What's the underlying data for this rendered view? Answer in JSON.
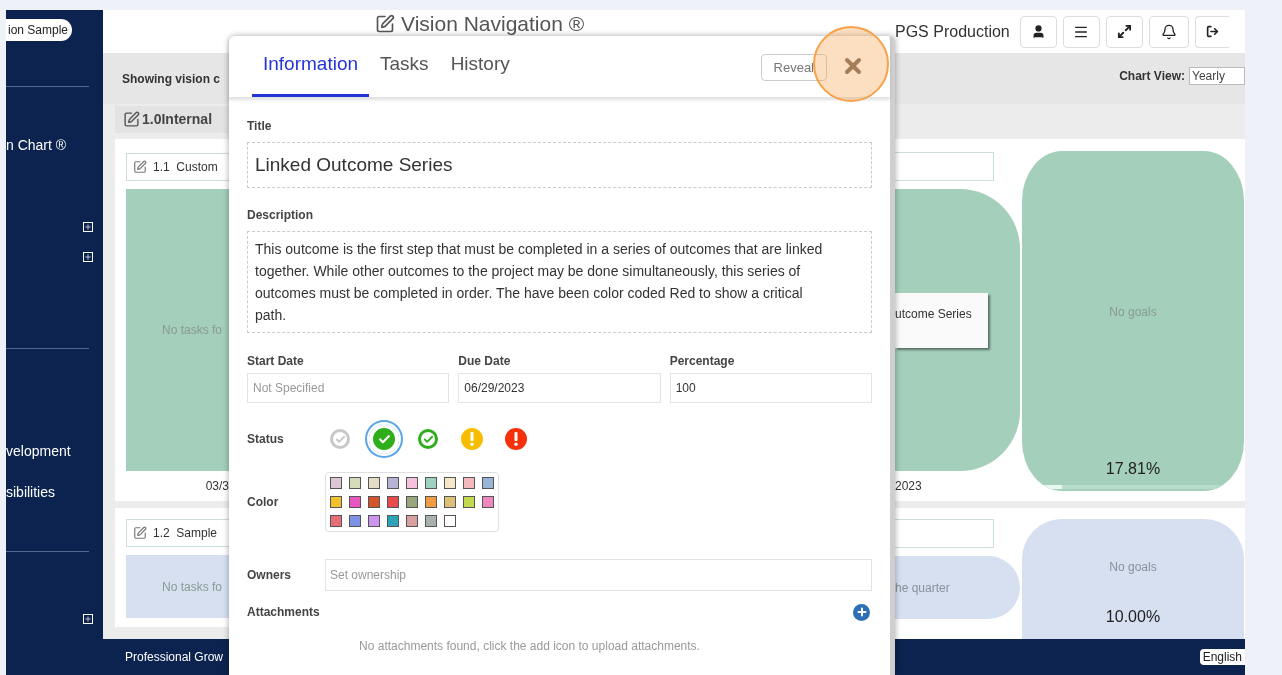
{
  "sidebar": {
    "workspace": "ion Sample",
    "items": [
      {
        "kind": "divider"
      },
      {
        "kind": "link",
        "label": "n Chart ®"
      },
      {
        "kind": "expand"
      },
      {
        "kind": "expand"
      },
      {
        "kind": "divider"
      },
      {
        "kind": "link",
        "label": "velopment"
      },
      {
        "kind": "link",
        "label": "sibilities"
      },
      {
        "kind": "divider"
      },
      {
        "kind": "expand"
      }
    ]
  },
  "header": {
    "title": "Vision Navigation ®",
    "org": "PGS Production"
  },
  "toolbar": {
    "caption": "Showing vision c",
    "chart_view_label": "Chart View:",
    "chart_view_value": "Yearly"
  },
  "section": {
    "title": "1.0Internal"
  },
  "rows": [
    {
      "goal": "1.1  Custom",
      "tasks_text": "No tasks fo",
      "date": "03/3",
      "color": "#a3cfbb",
      "detail": "utcome Series",
      "end_date": "2023",
      "summary": "No goals",
      "percent": "17.81%",
      "level": 0.178
    },
    {
      "goal": "1.2  Sample",
      "tasks_text": "No tasks fo",
      "color": "#d7e0f1",
      "note": "he quarter",
      "summary": "No goals",
      "percent": "10.00%"
    }
  ],
  "footer": {
    "text": "Professional Grow",
    "language": "English"
  },
  "modal": {
    "tabs": [
      {
        "label": "Information",
        "selected": true
      },
      {
        "label": "Tasks",
        "selected": false
      },
      {
        "label": "History",
        "selected": false
      }
    ],
    "reveal": "Reveal",
    "title_label": "Title",
    "title": "Linked Outcome Series",
    "description_label": "Description",
    "description": "This outcome is the first step that must be completed in a series of outcomes that are linked together. While other outcomes to the project may be done simultaneously, this series of outcomes must be completed in order. The have been color coded Red to show a critical path.",
    "dates": [
      {
        "label": "Start Date",
        "placeholder": "Not Specified"
      },
      {
        "label": "Due Date",
        "value": "06/29/2023"
      },
      {
        "label": "Percentage",
        "value": "100"
      }
    ],
    "status_label": "Status",
    "statuses": [
      {
        "kind": "check-ring",
        "color": "#c8c8c8",
        "selected": false
      },
      {
        "kind": "check-solid",
        "color": "#2fae1c",
        "selected": true
      },
      {
        "kind": "check-ring",
        "color": "#2fae1c",
        "selected": false
      },
      {
        "kind": "alert-solid",
        "color": "#f7bd00",
        "selected": false
      },
      {
        "kind": "alert-solid",
        "color": "#f5310c",
        "selected": false
      }
    ],
    "color_label": "Color",
    "swatches": [
      {
        "color": "#dcc6d6"
      },
      {
        "color": "#d3dbb8"
      },
      {
        "color": "#e6dcc6"
      },
      {
        "color": "#b7b3d6"
      },
      {
        "color": "#f5c1de"
      },
      {
        "color": "#9ed1bf"
      },
      {
        "color": "#f7e6c8"
      },
      {
        "color": "#f4b9bd"
      },
      {
        "color": "#97b4d6"
      },
      {
        "color": "#f2c12e"
      },
      {
        "color": "#e857bd"
      },
      {
        "color": "#d4552b"
      },
      {
        "color": "#e84b4b"
      },
      {
        "color": "#9aa67b"
      },
      {
        "color": "#ef9c45"
      },
      {
        "color": "#ddc078"
      },
      {
        "color": "#c3d94e"
      },
      {
        "color": "#ee86c0"
      },
      {
        "color": "#e46f77"
      },
      {
        "color": "#7f93e6"
      },
      {
        "color": "#cc94ee"
      },
      {
        "color": "#2ea3b8"
      },
      {
        "color": "#d9a0a0"
      },
      {
        "color": "#a9b1ad"
      },
      {
        "color": "#ffffff"
      }
    ],
    "owners_label": "Owners",
    "owners_placeholder": "Set ownership",
    "attachments_label": "Attachments",
    "attachments_empty": "No attachments found, click the add icon to upload attachments."
  }
}
